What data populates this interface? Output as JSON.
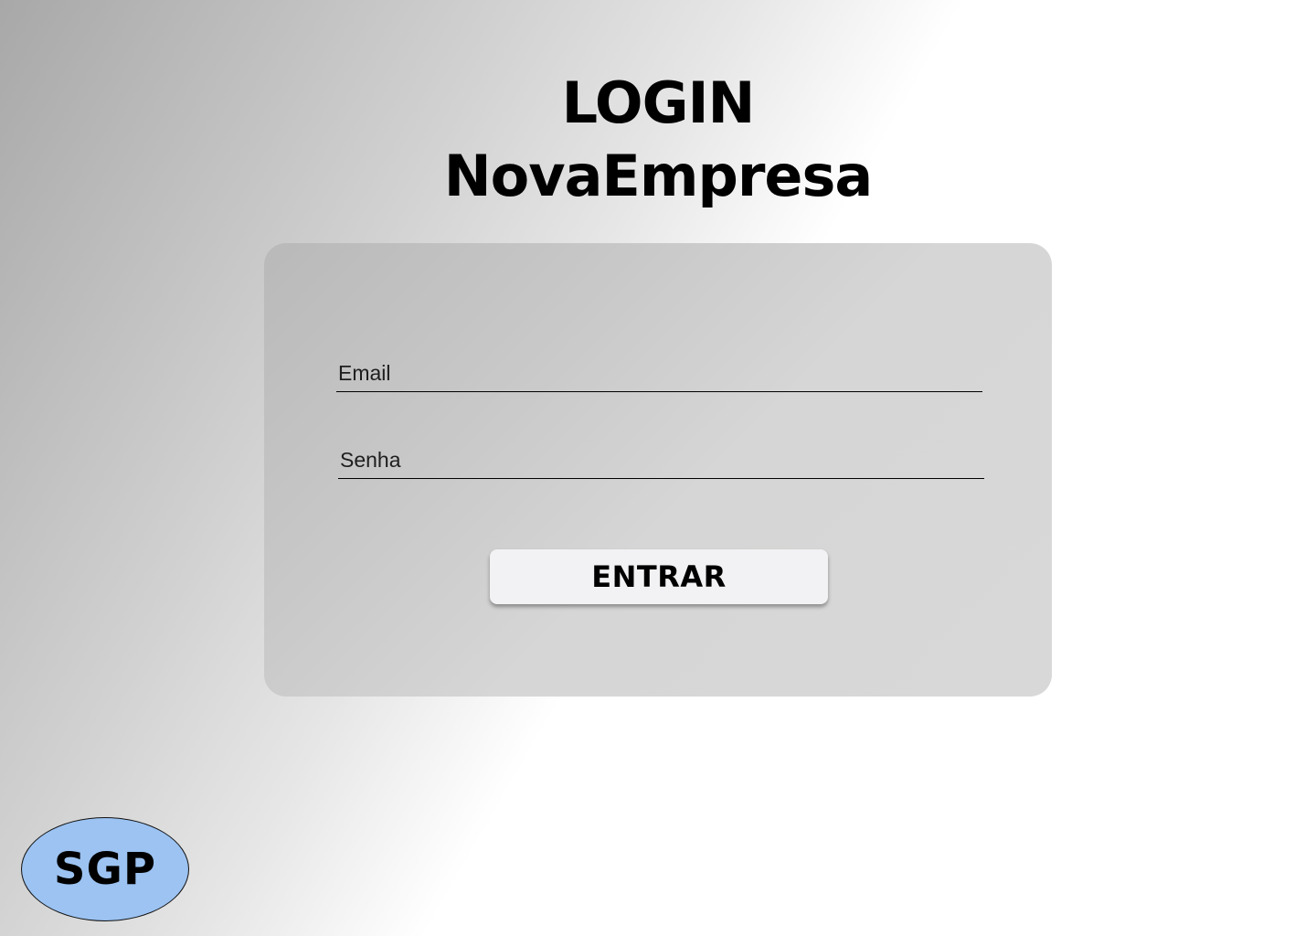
{
  "page": {
    "title_line1": "LOGIN",
    "title_line2": "NovaEmpresa"
  },
  "form": {
    "email": {
      "value": "",
      "placeholder": "Email"
    },
    "senha": {
      "value": "",
      "placeholder": "Senha"
    },
    "submit_label": "ENTRAR"
  },
  "logo": {
    "text": "SGP"
  },
  "colors": {
    "logo_background": "#9cc3f2",
    "button_background": "#f2f1f3",
    "card_background": "#d6d6d6"
  }
}
